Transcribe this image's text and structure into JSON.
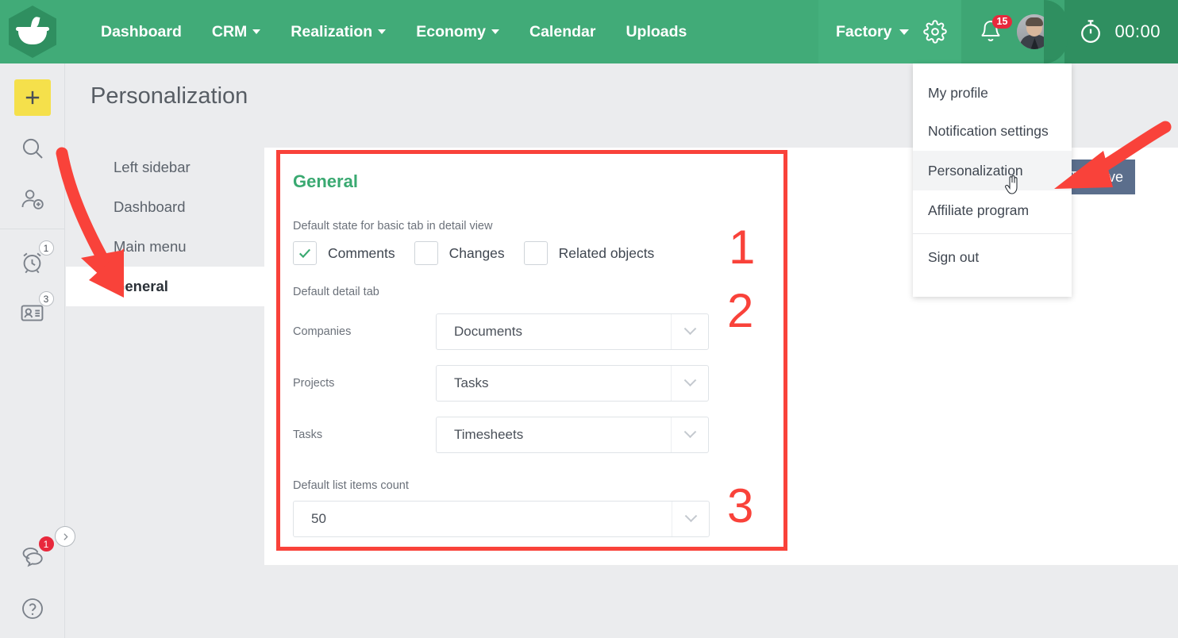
{
  "topbar": {
    "logo_name": "app-logo",
    "nav": [
      {
        "label": "Dashboard",
        "has_caret": false
      },
      {
        "label": "CRM",
        "has_caret": true
      },
      {
        "label": "Realization",
        "has_caret": true
      },
      {
        "label": "Economy",
        "has_caret": true
      },
      {
        "label": "Calendar",
        "has_caret": false
      },
      {
        "label": "Uploads",
        "has_caret": false
      }
    ],
    "tenant": "Factory",
    "gear_icon": "gear-icon",
    "bell_icon": "bell-icon",
    "notification_count": "15",
    "avatar_icon": "user-avatar",
    "timer_icon": "stopwatch-icon",
    "timer_value": "00:00",
    "bg_color": "#41ab78"
  },
  "rail": {
    "items": [
      {
        "name": "add-button",
        "icon": "plus-icon",
        "badge": null
      },
      {
        "name": "search-button",
        "icon": "search-icon",
        "badge": null
      },
      {
        "name": "add-contact-button",
        "icon": "user-plus-icon",
        "badge": null
      },
      {
        "name": "reminders-button",
        "icon": "alarm-clock-icon",
        "badge": "1"
      },
      {
        "name": "contacts-button",
        "icon": "contact-card-icon",
        "badge": "3"
      },
      {
        "name": "chat-button",
        "icon": "chat-bubble-icon",
        "badge": "1"
      },
      {
        "name": "help-button",
        "icon": "question-mark-icon",
        "badge": null
      }
    ],
    "expand_icon": "chevron-right-icon"
  },
  "page": {
    "title": "Personalization"
  },
  "settings_nav": {
    "items": [
      {
        "label": "Left sidebar",
        "active": false
      },
      {
        "label": "Dashboard",
        "active": false
      },
      {
        "label": "Main menu",
        "active": false
      },
      {
        "label": "General",
        "active": true
      }
    ]
  },
  "form": {
    "heading": "General",
    "checkbox_group_label": "Default state for basic tab in detail view",
    "checkboxes": [
      {
        "label": "Comments",
        "checked": true
      },
      {
        "label": "Changes",
        "checked": false
      },
      {
        "label": "Related objects",
        "checked": false
      }
    ],
    "detail_tab_label": "Default detail tab",
    "selects": [
      {
        "label": "Companies",
        "value": "Documents"
      },
      {
        "label": "Projects",
        "value": "Tasks"
      },
      {
        "label": "Tasks",
        "value": "Timesheets"
      }
    ],
    "list_count_label": "Default list items count",
    "list_count_value": "50",
    "heading_color": "#3aa971"
  },
  "annotations": {
    "numbers": [
      "1",
      "2",
      "3"
    ],
    "color": "#f9423a"
  },
  "save_button": {
    "label": "Save",
    "icon": "floppy-disk-icon",
    "color": "#5b6e8c"
  },
  "dropdown": {
    "items": [
      {
        "label": "My profile",
        "highlighted": false,
        "separator_after": false
      },
      {
        "label": "Notification settings",
        "highlighted": false,
        "separator_after": false
      },
      {
        "label": "Personalization",
        "highlighted": true,
        "separator_after": false
      },
      {
        "label": "Affiliate program",
        "highlighted": false,
        "separator_after": true
      },
      {
        "label": "Sign out",
        "highlighted": false,
        "separator_after": false
      }
    ]
  }
}
